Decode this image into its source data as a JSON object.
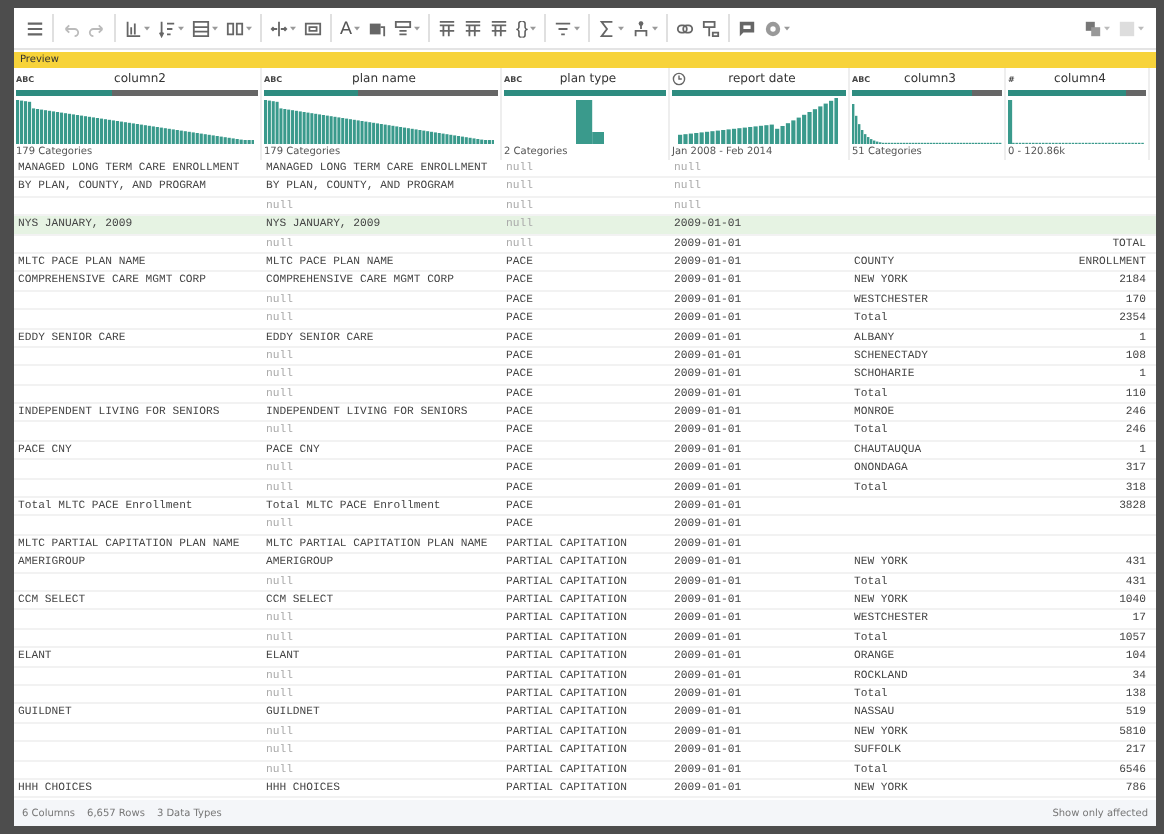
{
  "toolbar": {
    "text_buttons": [
      "A",
      "{}"
    ]
  },
  "preview": {
    "label": "Preview"
  },
  "columns": [
    {
      "name": "column2",
      "kind": "text",
      "type_label": "ABC",
      "quality": {
        "level": 0.4
      },
      "summary": "179 Categories"
    },
    {
      "name": "plan name",
      "kind": "text",
      "type_label": "ABC",
      "quality": {
        "level": 0.4
      },
      "summary": "179 Categories"
    },
    {
      "name": "plan type",
      "kind": "text",
      "type_label": "ABC",
      "quality": {
        "level": 1
      },
      "summary": "2 Categories"
    },
    {
      "name": "report date",
      "kind": "date",
      "quality": {
        "level": 1
      },
      "summary": "Jan 2008 - Feb 2014"
    },
    {
      "name": "column3",
      "kind": "text",
      "type_label": "ABC",
      "quality": {
        "level": 0.8
      },
      "summary": "51 Categories"
    },
    {
      "name": "column4",
      "kind": "number",
      "type_label": "#",
      "quality": {
        "level": 0.85
      },
      "summary": "0 - 120.86k"
    }
  ],
  "rows": [
    {
      "selected": false,
      "cells": {
        "column2": "MANAGED LONG TERM CARE ENROLLMENT",
        "plan_name": "MANAGED LONG TERM CARE ENROLLMENT",
        "plan_type": {
          "kind": "null",
          "text": "null"
        },
        "report_date": {
          "kind": "null",
          "text": "null"
        }
      }
    },
    {
      "selected": false,
      "cells": {
        "column2": "BY PLAN, COUNTY, AND PROGRAM",
        "plan_name": "BY PLAN, COUNTY, AND PROGRAM",
        "plan_type": {
          "kind": "null",
          "text": "null"
        },
        "report_date": {
          "kind": "null",
          "text": "null"
        }
      }
    },
    {
      "selected": false,
      "cells": {
        "plan_name": {
          "kind": "null",
          "text": "null"
        },
        "plan_type": {
          "kind": "null",
          "text": "null"
        },
        "report_date": {
          "kind": "null",
          "text": "null"
        }
      }
    },
    {
      "selected": true,
      "cells": {
        "column2": "NYS JANUARY,  2009",
        "plan_name": "NYS JANUARY,  2009",
        "plan_type": {
          "kind": "null",
          "text": "null"
        },
        "report_date": "2009-01-01"
      }
    },
    {
      "selected": false,
      "cells": {
        "plan_name": {
          "kind": "null",
          "text": "null"
        },
        "plan_type": {
          "kind": "null",
          "text": "null"
        },
        "report_date": "2009-01-01",
        "column4": "TOTAL"
      }
    },
    {
      "selected": false,
      "cells": {
        "column2": "MLTC PACE PLAN NAME",
        "plan_name": "MLTC PACE PLAN NAME",
        "plan_type": "PACE",
        "report_date": "2009-01-01",
        "column3": "COUNTY",
        "column4": "ENROLLMENT"
      }
    },
    {
      "selected": false,
      "cells": {
        "column2": "COMPREHENSIVE CARE MGMT CORP",
        "plan_name": "COMPREHENSIVE CARE MGMT CORP",
        "plan_type": "PACE",
        "report_date": "2009-01-01",
        "column3": "NEW YORK",
        "column4": "2184"
      }
    },
    {
      "selected": false,
      "cells": {
        "plan_name": {
          "kind": "null",
          "text": "null"
        },
        "plan_type": "PACE",
        "report_date": "2009-01-01",
        "column3": "WESTCHESTER",
        "column4": "170"
      }
    },
    {
      "selected": false,
      "cells": {
        "plan_name": {
          "kind": "null",
          "text": "null"
        },
        "plan_type": "PACE",
        "report_date": "2009-01-01",
        "column3": "Total",
        "column4": "2354"
      }
    },
    {
      "selected": false,
      "cells": {
        "column2": "EDDY SENIOR CARE",
        "plan_name": "EDDY SENIOR CARE",
        "plan_type": "PACE",
        "report_date": "2009-01-01",
        "column3": "ALBANY",
        "column4": "1"
      }
    },
    {
      "selected": false,
      "cells": {
        "plan_name": {
          "kind": "null",
          "text": "null"
        },
        "plan_type": "PACE",
        "report_date": "2009-01-01",
        "column3": "SCHENECTADY",
        "column4": "108"
      }
    },
    {
      "selected": false,
      "cells": {
        "plan_name": {
          "kind": "null",
          "text": "null"
        },
        "plan_type": "PACE",
        "report_date": "2009-01-01",
        "column3": "SCHOHARIE",
        "column4": "1"
      }
    },
    {
      "selected": false,
      "cells": {
        "plan_name": {
          "kind": "null",
          "text": "null"
        },
        "plan_type": "PACE",
        "report_date": "2009-01-01",
        "column3": "Total",
        "column4": "110"
      }
    },
    {
      "selected": false,
      "cells": {
        "column2": "INDEPENDENT LIVING FOR SENIORS",
        "plan_name": "INDEPENDENT LIVING FOR SENIORS",
        "plan_type": "PACE",
        "report_date": "2009-01-01",
        "column3": "MONROE",
        "column4": "246"
      }
    },
    {
      "selected": false,
      "cells": {
        "plan_name": {
          "kind": "null",
          "text": "null"
        },
        "plan_type": "PACE",
        "report_date": "2009-01-01",
        "column3": "Total",
        "column4": "246"
      }
    },
    {
      "selected": false,
      "cells": {
        "column2": "PACE CNY",
        "plan_name": "PACE CNY",
        "plan_type": "PACE",
        "report_date": "2009-01-01",
        "column3": "CHAUTAUQUA",
        "column4": "1"
      }
    },
    {
      "selected": false,
      "cells": {
        "plan_name": {
          "kind": "null",
          "text": "null"
        },
        "plan_type": "PACE",
        "report_date": "2009-01-01",
        "column3": "ONONDAGA",
        "column4": "317"
      }
    },
    {
      "selected": false,
      "cells": {
        "plan_name": {
          "kind": "null",
          "text": "null"
        },
        "plan_type": "PACE",
        "report_date": "2009-01-01",
        "column3": "Total",
        "column4": "318"
      }
    },
    {
      "selected": false,
      "cells": {
        "column2": "Total MLTC PACE Enrollment",
        "plan_name": "Total MLTC PACE Enrollment",
        "plan_type": "PACE",
        "report_date": "2009-01-01",
        "column4": "3828"
      }
    },
    {
      "selected": false,
      "cells": {
        "plan_name": {
          "kind": "null",
          "text": "null"
        },
        "plan_type": "PACE",
        "report_date": "2009-01-01"
      }
    },
    {
      "selected": false,
      "cells": {
        "column2": "MLTC PARTIAL CAPITATION PLAN NAME",
        "plan_name": "MLTC PARTIAL CAPITATION PLAN NAME",
        "plan_type": "PARTIAL CAPITATION",
        "report_date": "2009-01-01"
      }
    },
    {
      "selected": false,
      "cells": {
        "column2": "AMERIGROUP",
        "plan_name": "AMERIGROUP",
        "plan_type": "PARTIAL CAPITATION",
        "report_date": "2009-01-01",
        "column3": "NEW YORK",
        "column4": "431"
      }
    },
    {
      "selected": false,
      "cells": {
        "plan_name": {
          "kind": "null",
          "text": "null"
        },
        "plan_type": "PARTIAL CAPITATION",
        "report_date": "2009-01-01",
        "column3": "Total",
        "column4": "431"
      }
    },
    {
      "selected": false,
      "cells": {
        "column2": "CCM SELECT",
        "plan_name": "CCM SELECT",
        "plan_type": "PARTIAL CAPITATION",
        "report_date": "2009-01-01",
        "column3": "NEW YORK",
        "column4": "1040"
      }
    },
    {
      "selected": false,
      "cells": {
        "plan_name": {
          "kind": "null",
          "text": "null"
        },
        "plan_type": "PARTIAL CAPITATION",
        "report_date": "2009-01-01",
        "column3": "WESTCHESTER",
        "column4": "17"
      }
    },
    {
      "selected": false,
      "cells": {
        "plan_name": {
          "kind": "null",
          "text": "null"
        },
        "plan_type": "PARTIAL CAPITATION",
        "report_date": "2009-01-01",
        "column3": "Total",
        "column4": "1057"
      }
    },
    {
      "selected": false,
      "cells": {
        "column2": "ELANT",
        "plan_name": "ELANT",
        "plan_type": "PARTIAL CAPITATION",
        "report_date": "2009-01-01",
        "column3": "ORANGE",
        "column4": "104"
      }
    },
    {
      "selected": false,
      "cells": {
        "plan_name": {
          "kind": "null",
          "text": "null"
        },
        "plan_type": "PARTIAL CAPITATION",
        "report_date": "2009-01-01",
        "column3": "ROCKLAND",
        "column4": "34"
      }
    },
    {
      "selected": false,
      "cells": {
        "plan_name": {
          "kind": "null",
          "text": "null"
        },
        "plan_type": "PARTIAL CAPITATION",
        "report_date": "2009-01-01",
        "column3": "Total",
        "column4": "138"
      }
    },
    {
      "selected": false,
      "cells": {
        "column2": "GUILDNET",
        "plan_name": "GUILDNET",
        "plan_type": "PARTIAL CAPITATION",
        "report_date": "2009-01-01",
        "column3": "NASSAU",
        "column4": "519"
      }
    },
    {
      "selected": false,
      "cells": {
        "plan_name": {
          "kind": "null",
          "text": "null"
        },
        "plan_type": "PARTIAL CAPITATION",
        "report_date": "2009-01-01",
        "column3": "NEW YORK",
        "column4": "5810"
      }
    },
    {
      "selected": false,
      "cells": {
        "plan_name": {
          "kind": "null",
          "text": "null"
        },
        "plan_type": "PARTIAL CAPITATION",
        "report_date": "2009-01-01",
        "column3": "SUFFOLK",
        "column4": "217"
      }
    },
    {
      "selected": false,
      "cells": {
        "plan_name": {
          "kind": "null",
          "text": "null"
        },
        "plan_type": "PARTIAL CAPITATION",
        "report_date": "2009-01-01",
        "column3": "Total",
        "column4": "6546"
      }
    },
    {
      "selected": false,
      "cells": {
        "column2": "HHH CHOICES",
        "plan_name": "HHH CHOICES",
        "plan_type": "PARTIAL CAPITATION",
        "report_date": "2009-01-01",
        "column3": "NEW YORK",
        "column4": "786"
      }
    }
  ],
  "status_bar": {
    "items": [
      "6 Columns",
      "6,657 Rows",
      "3 Data Types"
    ],
    "action": "Show only affected"
  }
}
